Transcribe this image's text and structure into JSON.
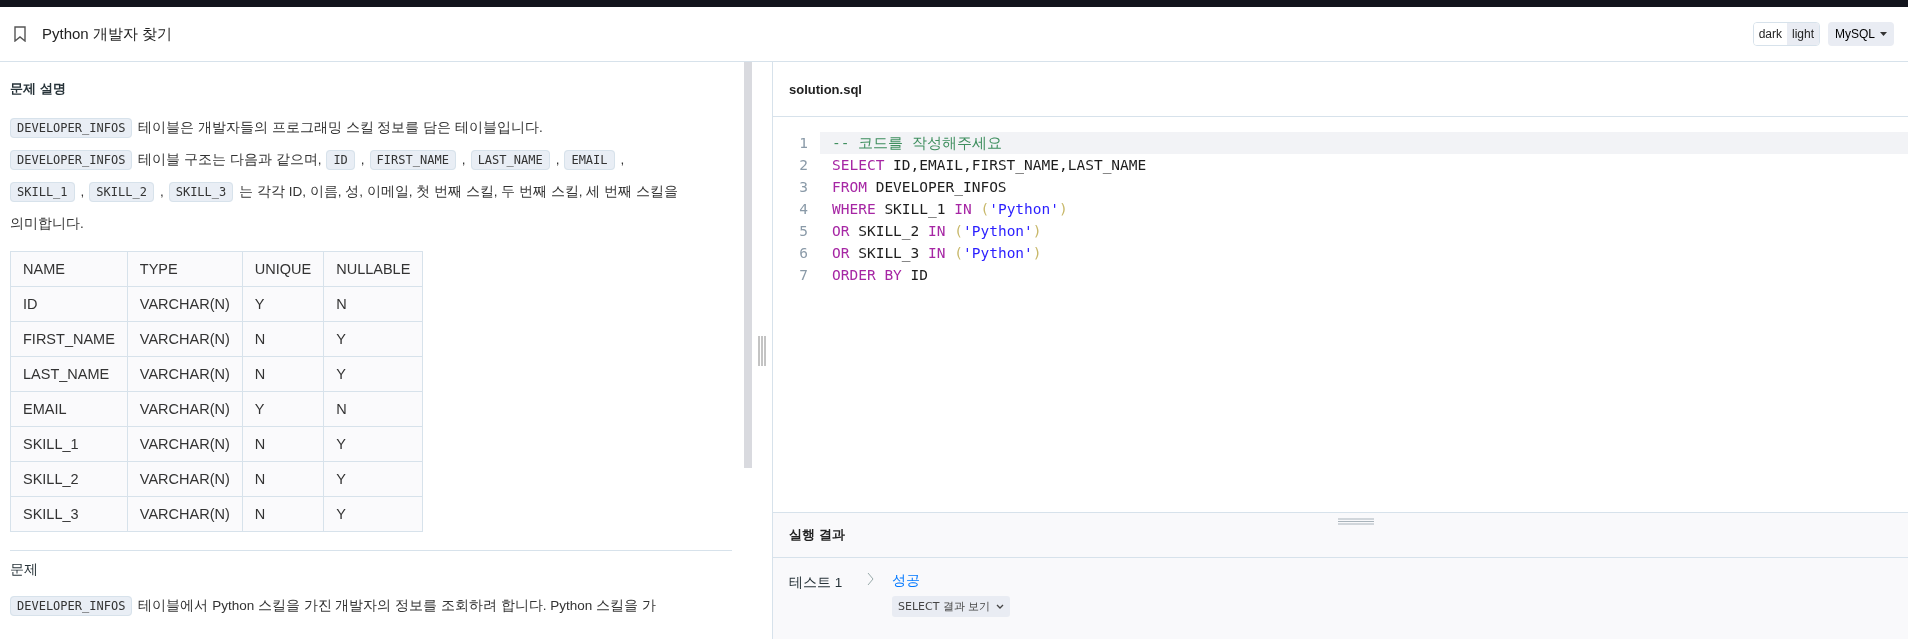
{
  "header": {
    "title": "Python 개발자 찾기",
    "theme_options": [
      {
        "label": "dark",
        "selected": false
      },
      {
        "label": "light",
        "selected": true
      }
    ],
    "language": "MySQL"
  },
  "description": {
    "heading": "문제 설명",
    "paragraph_lines": [
      [
        {
          "kind": "code",
          "text": "DEVELOPER_INFOS"
        },
        {
          "kind": "text",
          "text": "테이블은 개발자들의 프로그래밍 스킬 정보를 담은 테이블입니다."
        }
      ],
      [
        {
          "kind": "code",
          "text": "DEVELOPER_INFOS"
        },
        {
          "kind": "text",
          "text": "테이블 구조는 다음과 같으며,"
        },
        {
          "kind": "code",
          "text": "ID"
        },
        {
          "kind": "text",
          "text": ","
        },
        {
          "kind": "code",
          "text": "FIRST_NAME"
        },
        {
          "kind": "text",
          "text": ","
        },
        {
          "kind": "code",
          "text": "LAST_NAME"
        },
        {
          "kind": "text",
          "text": ","
        },
        {
          "kind": "code",
          "text": "EMAIL"
        },
        {
          "kind": "text",
          "text": ","
        }
      ],
      [
        {
          "kind": "code",
          "text": "SKILL_1"
        },
        {
          "kind": "text",
          "text": ","
        },
        {
          "kind": "code",
          "text": "SKILL_2"
        },
        {
          "kind": "text",
          "text": ","
        },
        {
          "kind": "code",
          "text": "SKILL_3"
        },
        {
          "kind": "text",
          "text": "는 각각 ID, 이름, 성, 이메일, 첫 번째 스킬, 두 번째 스킬, 세 번째 스킬을"
        }
      ],
      [
        {
          "kind": "text",
          "text": "의미합니다."
        }
      ]
    ],
    "table": {
      "columns": [
        "NAME",
        "TYPE",
        "UNIQUE",
        "NULLABLE"
      ],
      "rows": [
        [
          "ID",
          "VARCHAR(N)",
          "Y",
          "N"
        ],
        [
          "FIRST_NAME",
          "VARCHAR(N)",
          "N",
          "Y"
        ],
        [
          "LAST_NAME",
          "VARCHAR(N)",
          "N",
          "Y"
        ],
        [
          "EMAIL",
          "VARCHAR(N)",
          "Y",
          "N"
        ],
        [
          "SKILL_1",
          "VARCHAR(N)",
          "N",
          "Y"
        ],
        [
          "SKILL_2",
          "VARCHAR(N)",
          "N",
          "Y"
        ],
        [
          "SKILL_3",
          "VARCHAR(N)",
          "N",
          "Y"
        ]
      ]
    },
    "problem_heading": "문제",
    "problem_paragraph": [
      {
        "kind": "code",
        "text": "DEVELOPER_INFOS"
      },
      {
        "kind": "text",
        "text": "테이블에서 Python 스킬을 가진 개발자의 정보를 조회하려 합니다. Python 스킬을 가"
      }
    ]
  },
  "editor": {
    "filename": "solution.sql",
    "lines": [
      {
        "number": "1",
        "highlighted": true,
        "tokens": [
          {
            "kind": "comment",
            "text": "-- 코드를 작성해주세요"
          }
        ]
      },
      {
        "number": "2",
        "highlighted": false,
        "tokens": [
          {
            "kind": "keyword",
            "text": "SELECT"
          },
          {
            "kind": "plain",
            "text": " ID,EMAIL,FIRST_NAME,LAST_NAME"
          }
        ]
      },
      {
        "number": "3",
        "highlighted": false,
        "tokens": [
          {
            "kind": "keyword",
            "text": "FROM"
          },
          {
            "kind": "plain",
            "text": " DEVELOPER_INFOS"
          }
        ]
      },
      {
        "number": "4",
        "highlighted": false,
        "tokens": [
          {
            "kind": "keyword",
            "text": "WHERE"
          },
          {
            "kind": "plain",
            "text": " SKILL_1 "
          },
          {
            "kind": "keyword",
            "text": "IN"
          },
          {
            "kind": "paren",
            "text": " ("
          },
          {
            "kind": "string",
            "text": "'Python'"
          },
          {
            "kind": "paren",
            "text": ")"
          }
        ]
      },
      {
        "number": "5",
        "highlighted": false,
        "tokens": [
          {
            "kind": "keyword",
            "text": "OR"
          },
          {
            "kind": "plain",
            "text": " SKILL_2 "
          },
          {
            "kind": "keyword",
            "text": "IN"
          },
          {
            "kind": "paren",
            "text": " ("
          },
          {
            "kind": "string",
            "text": "'Python'"
          },
          {
            "kind": "paren",
            "text": ")"
          }
        ]
      },
      {
        "number": "6",
        "highlighted": false,
        "tokens": [
          {
            "kind": "keyword",
            "text": "OR"
          },
          {
            "kind": "plain",
            "text": " SKILL_3 "
          },
          {
            "kind": "keyword",
            "text": "IN"
          },
          {
            "kind": "paren",
            "text": " ("
          },
          {
            "kind": "string",
            "text": "'Python'"
          },
          {
            "kind": "paren",
            "text": ")"
          }
        ]
      },
      {
        "number": "7",
        "highlighted": false,
        "tokens": [
          {
            "kind": "keyword",
            "text": "ORDER BY"
          },
          {
            "kind": "plain",
            "text": " ID"
          }
        ]
      }
    ]
  },
  "result": {
    "heading": "실행 결과",
    "tests": [
      {
        "label": "테스트 1",
        "status": "성공",
        "success": true,
        "button": "SELECT 결과 보기"
      }
    ]
  }
}
